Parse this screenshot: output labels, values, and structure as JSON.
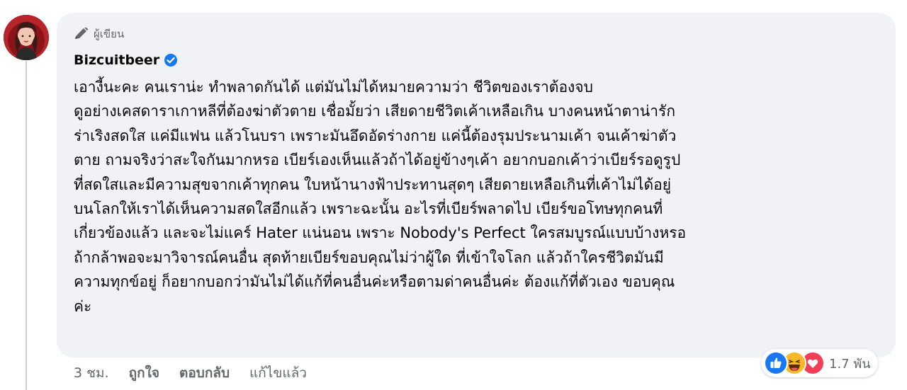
{
  "author_badge": {
    "label": "ผู้เขียน",
    "icon": "pencil-icon"
  },
  "comment": {
    "author_name": "Bizcuitbeer",
    "verified_icon": "verified-badge-icon",
    "lines": [
      "เอางี้นะคะ คนเราน่ะ ทำพลาดกันได้ แต่มันไม่ได้หมายความว่า ชีวิตของเราต้องจบ",
      "ดูอย่างเคสดาราเกาหลีที่ต้องฆ่าตัวตาย เชื่อมั้ยว่า เสียดายชีวิตเค้าเหลือเกิน บางคนหน้าตาน่ารัก",
      "ร่าเริงสดใส แค่มีแฟน แล้วโนบรา เพราะมันอึดอัดร่างกาย แค่นี้ต้องรุมประนามเค้า จนเค้าฆ่าตัว",
      "ตาย ถามจริงว่าสะใจกันมากหรอ เบียร์เองเห็นแล้วถ้าได้อยู่ข้างๆเค้า อยากบอกเค้าว่าเบียร์รอดูรูป",
      "ที่สดใสและมีความสุขจากเค้าทุกคน ใบหน้านางฟ้าประทานสุดๆ เสียดายเหลือเกินที่เค้าไม่ได้อยู่",
      "บนโลกให้เราได้เห็นความสดใสอีกแล้ว เพราะฉะนั้น อะไรที่เบียร์พลาดไป เบียร์ขอโทษทุกคนที่",
      "เกี่ยวข้องแล้ว และจะไม่แคร์ Hater แน่นอน เพราะ Nobody's Perfect ใครสมบูรณ์แบบบ้างหรอ",
      "ถ้ากล้าพอจะมาวิจารณ์คนอื่น สุดท้ายเบียร์ขอบคุณไม่ว่าผู้ใด ที่เข้าใจโลก แล้วถ้าใครชีวิตมันมี",
      "ความทุกข์อยู่ ก็อยากบอกว่ามันไม่ได้แก้ที่คนอื่นค่ะหรือตามด่าคนอื่นค่ะ ต้องแก้ที่ตัวเอง ขอบคุณ",
      "ค่ะ"
    ]
  },
  "reactions": {
    "icons": [
      "like-icon",
      "haha-icon",
      "love-icon"
    ],
    "count": "1.7 พัน"
  },
  "actions": {
    "time": "3 ชม.",
    "like": "ถูกใจ",
    "reply": "ตอบกลับ",
    "edited": "แก้ไขแล้ว"
  },
  "colors": {
    "bubble_bg": "#f0f2f5",
    "verified_blue": "#1877f2",
    "secondary_text": "#65676b",
    "love_red": "#f33e58",
    "haha_yellow": "#f7b928"
  }
}
